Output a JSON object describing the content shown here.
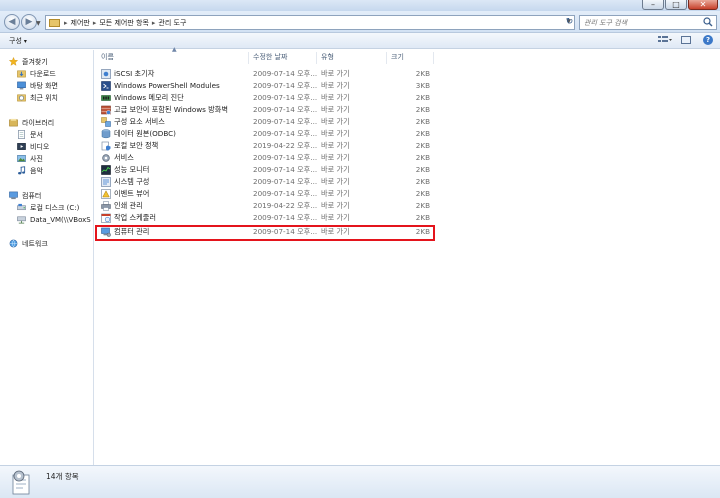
{
  "window": {
    "minimize_glyph": "–",
    "maximize_glyph": "□",
    "close_glyph": "✕"
  },
  "nav": {
    "back_icon": "back-arrow-icon",
    "forward_icon": "forward-arrow-icon",
    "breadcrumb": [
      "제어판",
      "모든 제어판 항목",
      "관리 도구"
    ],
    "breadcrumb_separator": "▸",
    "search_placeholder": "관리 도구 검색"
  },
  "toolbar": {
    "organize_label": "구성",
    "organize_arrow": "▾",
    "help_glyph": "?"
  },
  "sidebar": {
    "favorites": {
      "label": "즐겨찾기",
      "items": [
        "다운로드",
        "바탕 화면",
        "최근 위치"
      ]
    },
    "libraries": {
      "label": "라이브러리",
      "items": [
        "문서",
        "비디오",
        "사진",
        "음악"
      ]
    },
    "computer": {
      "label": "컴퓨터",
      "items": [
        "로컬 디스크 (C:)",
        "Data_VM(\\\\VBoxS"
      ]
    },
    "network": {
      "label": "네트워크"
    }
  },
  "columns": {
    "name": "이름",
    "date": "수정한 날짜",
    "type": "유형",
    "size": "크기"
  },
  "files": [
    {
      "name": "iSCSI 초기자",
      "date": "2009-07-14 오후...",
      "type": "바로 가기",
      "size": "2KB",
      "icon": "iscsi-icon"
    },
    {
      "name": "Windows PowerShell Modules",
      "date": "2009-07-14 오후...",
      "type": "바로 가기",
      "size": "3KB",
      "icon": "powershell-icon"
    },
    {
      "name": "Windows 메모리 진단",
      "date": "2009-07-14 오후...",
      "type": "바로 가기",
      "size": "2KB",
      "icon": "memory-diagnostic-icon"
    },
    {
      "name": "고급 보안이 포함된 Windows 방화벽",
      "date": "2009-07-14 오후...",
      "type": "바로 가기",
      "size": "2KB",
      "icon": "firewall-icon"
    },
    {
      "name": "구성 요소 서비스",
      "date": "2009-07-14 오후...",
      "type": "바로 가기",
      "size": "2KB",
      "icon": "component-services-icon"
    },
    {
      "name": "데이터 원본(ODBC)",
      "date": "2009-07-14 오후...",
      "type": "바로 가기",
      "size": "2KB",
      "icon": "odbc-icon"
    },
    {
      "name": "로컬 보안 정책",
      "date": "2019-04-22 오후...",
      "type": "바로 가기",
      "size": "2KB",
      "icon": "security-policy-icon"
    },
    {
      "name": "서비스",
      "date": "2009-07-14 오후...",
      "type": "바로 가기",
      "size": "2KB",
      "icon": "services-icon"
    },
    {
      "name": "성능 모니터",
      "date": "2009-07-14 오후...",
      "type": "바로 가기",
      "size": "2KB",
      "icon": "performance-monitor-icon"
    },
    {
      "name": "시스템 구성",
      "date": "2009-07-14 오후...",
      "type": "바로 가기",
      "size": "2KB",
      "icon": "system-config-icon"
    },
    {
      "name": "이벤트 뷰어",
      "date": "2009-07-14 오후...",
      "type": "바로 가기",
      "size": "2KB",
      "icon": "event-viewer-icon"
    },
    {
      "name": "인쇄 관리",
      "date": "2019-04-22 오후...",
      "type": "바로 가기",
      "size": "2KB",
      "icon": "print-management-icon"
    },
    {
      "name": "작업 스케줄러",
      "date": "2009-07-14 오후...",
      "type": "바로 가기",
      "size": "2KB",
      "icon": "task-scheduler-icon"
    },
    {
      "name": "컴퓨터 관리",
      "date": "2009-07-14 오후...",
      "type": "바로 가기",
      "size": "2KB",
      "icon": "computer-management-icon"
    }
  ],
  "status": {
    "item_count": "14개 항목"
  },
  "colors": {
    "highlight_border": "#e4141c",
    "star": "#f2b51f",
    "folder": "#e6c56a"
  }
}
